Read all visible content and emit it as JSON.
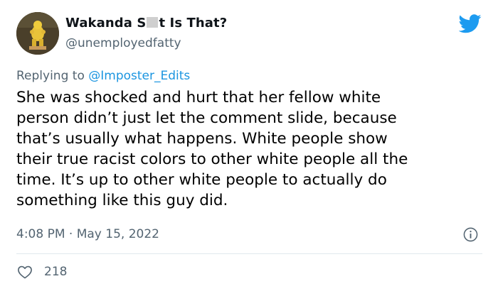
{
  "author": {
    "display_name_start": "Wakanda S",
    "display_name_end": "t Is That?",
    "handle": "@unemployedfatty"
  },
  "icons": {
    "brand": "twitter-bird-icon",
    "info": "info-icon",
    "like": "heart-icon",
    "brand_color": "#1d9bf0"
  },
  "reply": {
    "prefix": "Replying to",
    "mention": "@Imposter_Edits"
  },
  "tweet": {
    "lines": [
      "She was shocked and hurt that her fellow white",
      "person didn’t just let the comment slide, because",
      "that’s usually what happens. White people show",
      "their true racist colors to other white people all the",
      "time. It’s up to other white people to actually do",
      "something like this guy did."
    ],
    "timestamp": "4:08 PM · May 15, 2022"
  },
  "stats": {
    "likes": "218"
  }
}
